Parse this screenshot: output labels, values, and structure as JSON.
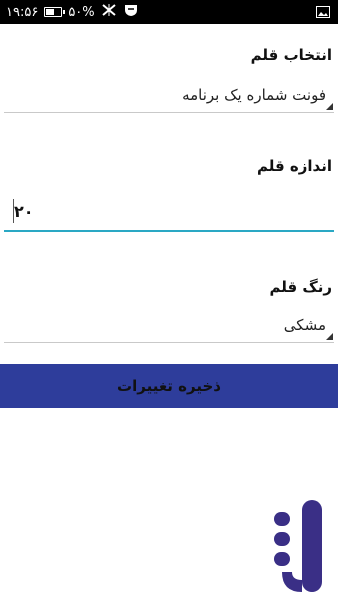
{
  "status_bar": {
    "time": "۱۹:۵۶",
    "battery_percent": "۵۰%"
  },
  "settings": {
    "font_label": "انتخاب قلم",
    "font_value": "فونت شماره یک برنامه",
    "size_label": "اندازه قلم",
    "size_value": "۲۰",
    "color_label": "رنگ قلم",
    "color_value": "مشکی",
    "save_label": "ذخیره تغییرات"
  },
  "colors": {
    "status_bar": "#000000",
    "accent_underline": "#2aa8c4",
    "save_button": "#2e3d9b",
    "logo": "#3a2f86"
  }
}
